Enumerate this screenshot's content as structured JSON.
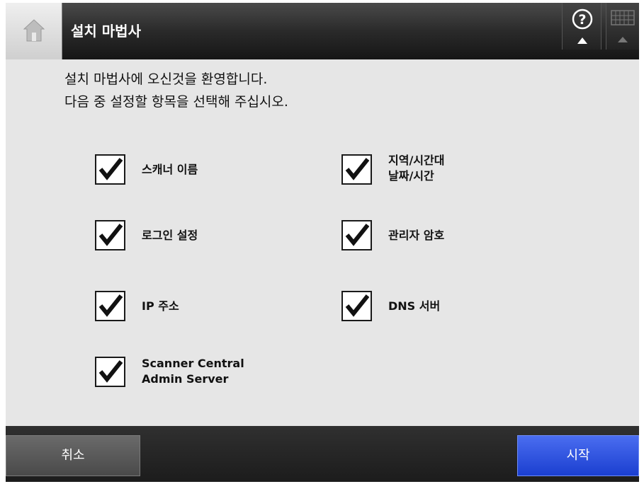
{
  "header": {
    "title": "설치 마법사",
    "home_icon": "home-icon",
    "help_icon": "help-icon",
    "keyboard_icon": "keyboard-icon"
  },
  "intro": {
    "line1": "설치 마법사에 오신것을 환영합니다.",
    "line2": "다음 중 설정할 항목을 선택해 주십시오."
  },
  "options": [
    {
      "line1": "스캐너 이름",
      "line2": "",
      "checked": true
    },
    {
      "line1": "지역/시간대",
      "line2": "날짜/시간",
      "checked": true
    },
    {
      "line1": "로그인 설정",
      "line2": "",
      "checked": true
    },
    {
      "line1": "관리자 암호",
      "line2": "",
      "checked": true
    },
    {
      "line1": "IP 주소",
      "line2": "",
      "checked": true
    },
    {
      "line1": "DNS 서버",
      "line2": "",
      "checked": true
    },
    {
      "line1": "Scanner Central",
      "line2": "Admin Server",
      "checked": true
    }
  ],
  "footer": {
    "cancel_label": "취소",
    "start_label": "시작"
  },
  "colors": {
    "start_button": "#1b3fd0",
    "panel_bg": "#e6e6e6"
  }
}
